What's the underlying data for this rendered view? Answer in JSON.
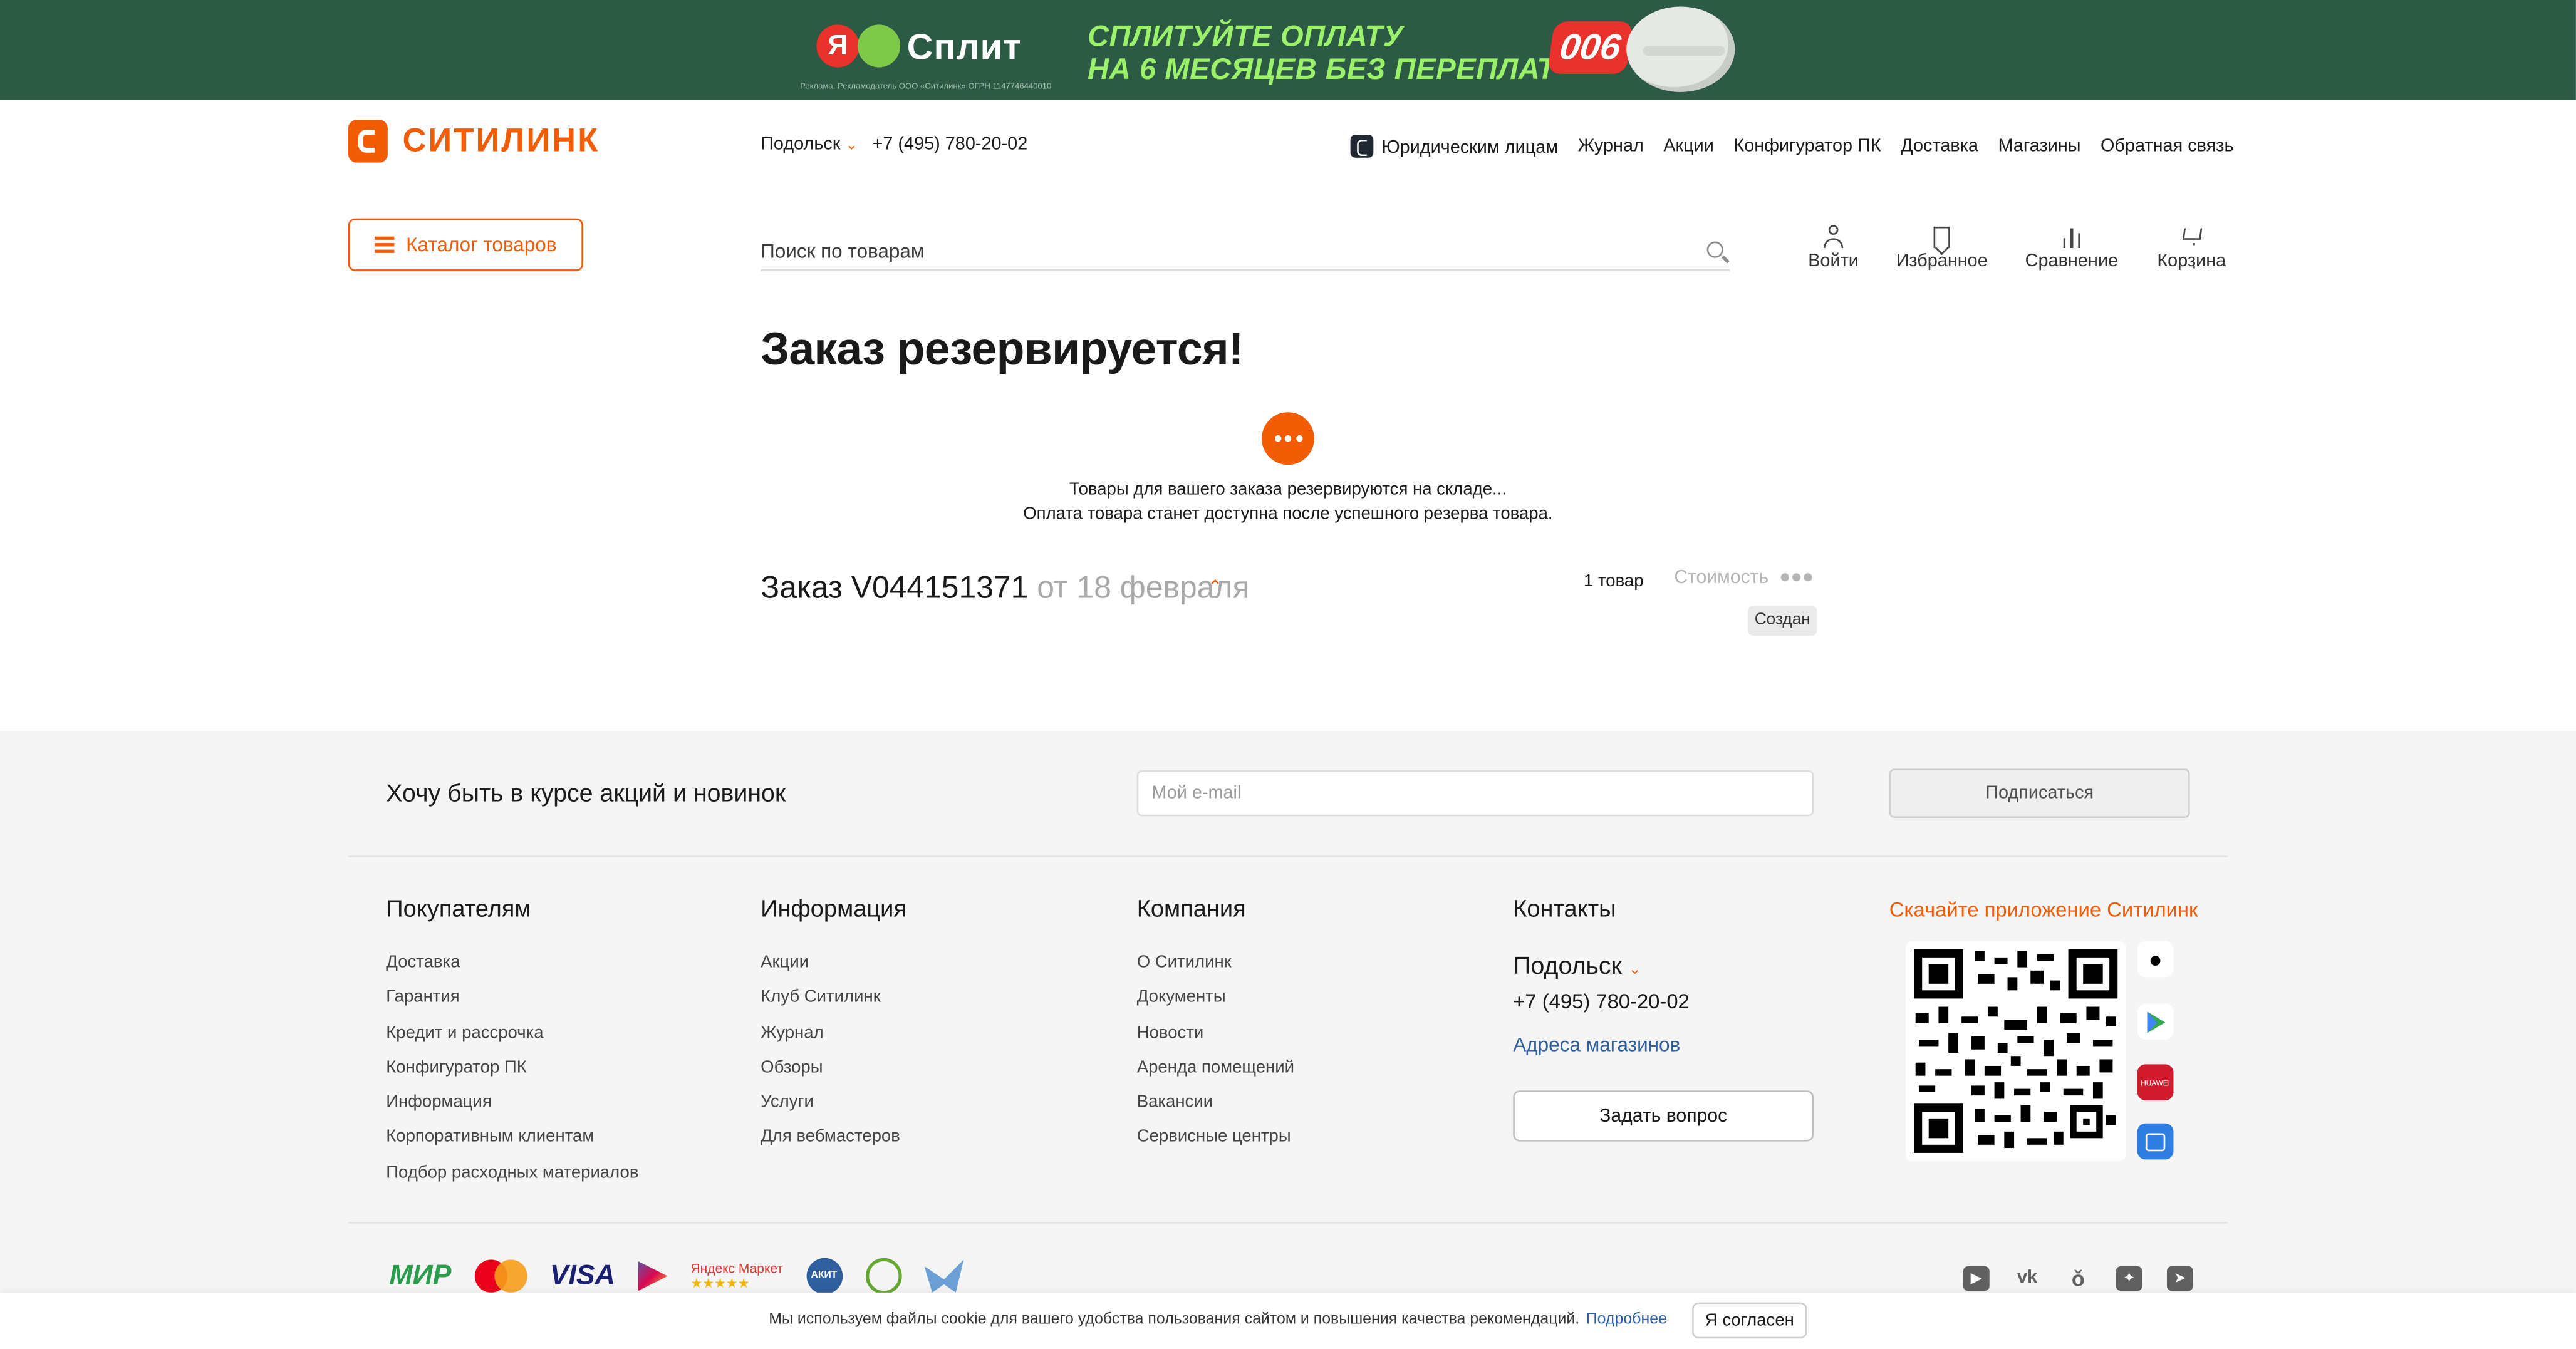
{
  "banner": {
    "ya": "Я",
    "brand": "Сплит",
    "legal": "Реклама. Рекламодатель ООО «Ситилинк» ОГРН 1147746440010",
    "promo_line1": "СПЛИТУЙТЕ ОПЛАТУ",
    "promo_line2": "НА 6 МЕСЯЦЕВ БЕЗ ПЕРЕПЛАТ",
    "badge": "006"
  },
  "header": {
    "logo": "СИТИЛИНК",
    "city": "Подольск",
    "phone": "+7 (495) 780-20-02",
    "nav": [
      "Юридическим лицам",
      "Журнал",
      "Акции",
      "Конфигуратор ПК",
      "Доставка",
      "Магазины",
      "Обратная связь"
    ],
    "catalog": "Каталог товаров",
    "search_placeholder": "Поиск по товарам",
    "icons": {
      "login": "Войти",
      "favorites": "Избранное",
      "compare": "Сравнение",
      "cart": "Корзина"
    }
  },
  "main": {
    "title": "Заказ резервируется!",
    "message_line1": "Товары для вашего заказа резервируются на складе...",
    "message_line2": "Оплата товара станет доступна после успешного резерва товара.",
    "order_label": "Заказ V044151371",
    "order_date": "от 18 февраля",
    "items_count": "1 товар",
    "cost_label": "Стоимость",
    "status": "Создан"
  },
  "footer": {
    "subscribe_title": "Хочу быть в курсе акций и новинок",
    "email_placeholder": "Мой e-mail",
    "subscribe_button": "Подписаться",
    "columns": [
      {
        "title": "Покупателям",
        "links": [
          "Доставка",
          "Гарантия",
          "Кредит и рассрочка",
          "Конфигуратор ПК",
          "Информация",
          "Корпоративным клиентам",
          "Подбор расходных материалов"
        ]
      },
      {
        "title": "Информация",
        "links": [
          "Акции",
          "Клуб Ситилинк",
          "Журнал",
          "Обзоры",
          "Услуги",
          "Для вебмастеров"
        ]
      },
      {
        "title": "Компания",
        "links": [
          "О Ситилинк",
          "Документы",
          "Новости",
          "Аренда помещений",
          "Вакансии",
          "Сервисные центры"
        ]
      }
    ],
    "contacts": {
      "title": "Контакты",
      "city": "Подольск",
      "phone": "+7 (495) 780-20-02",
      "addresses": "Адреса магазинов",
      "ask": "Задать вопрос"
    },
    "app_title": "Скачайте приложение Ситилинк",
    "payments": [
      "МИР",
      "Mastercard",
      "VISA",
      "Яндекс Маркет",
      "АКИТ"
    ],
    "huawei": "HUAWEI",
    "socials": [
      "youtube-icon",
      "vk-icon",
      "ok-icon",
      "dzen-icon",
      "telegram-icon"
    ]
  },
  "cookie": {
    "text": "Мы используем файлы cookie для вашего удобства пользования сайтом и повышения качества рекомендаций.",
    "more": "Подробнее",
    "agree": "Я согласен"
  },
  "colors": {
    "accent": "#f25c05",
    "banner_bg": "#2d5a45",
    "footer_bg": "#f5f5f5",
    "link": "#2f5f9f"
  }
}
